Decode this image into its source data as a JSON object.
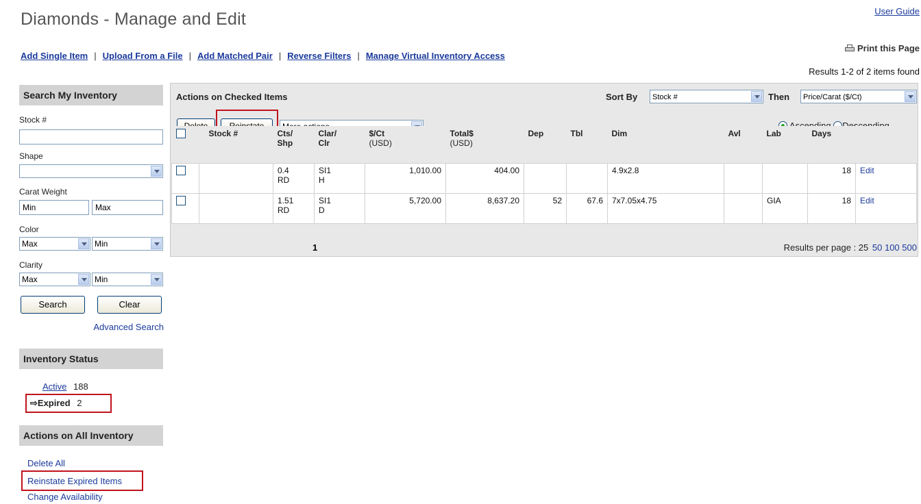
{
  "page": {
    "title": "Diamonds - Manage and Edit",
    "user_guide": "User Guide",
    "print": "Print this Page",
    "results_found": "Results 1-2 of 2 items found"
  },
  "nav": [
    {
      "label": "Add Single Item"
    },
    {
      "label": "Upload From a File"
    },
    {
      "label": "Add Matched Pair"
    },
    {
      "label": "Reverse Filters"
    },
    {
      "label": "Manage Virtual Inventory Access"
    }
  ],
  "search": {
    "heading": "Search My Inventory",
    "stock_label": "Stock #",
    "stock_value": "",
    "shape_label": "Shape",
    "shape_value": "",
    "carat_label": "Carat Weight",
    "carat_min": "Min",
    "carat_max": "Max",
    "color_label": "Color",
    "color_from": "Max",
    "color_to": "Min",
    "clarity_label": "Clarity",
    "clarity_from": "Max",
    "clarity_to": "Min",
    "search_button": "Search",
    "clear_button": "Clear",
    "advanced": "Advanced Search"
  },
  "status": {
    "heading": "Inventory Status",
    "active_label": "Active",
    "active_count": "188",
    "expired_label": "Expired",
    "expired_count": "2"
  },
  "actions_all": {
    "heading": "Actions on All Inventory",
    "items": [
      "Delete All",
      "Reinstate Expired Items",
      "Change Availability"
    ]
  },
  "checked": {
    "heading": "Actions on Checked Items",
    "delete": "Delete",
    "reinstate": "Reinstate",
    "more_actions": "More actions",
    "sort_by_label": "Sort By",
    "sort_by_value": "Stock #",
    "then_label": "Then",
    "then_value": "Price/Carat ($/Ct)",
    "ascending": "Ascending",
    "descending": "Descending"
  },
  "table": {
    "headers": [
      "Stock #",
      "Cts/",
      "Shp",
      "Clar/",
      "Clr",
      "$/Ct",
      "(USD)",
      "Total$",
      "(USD)",
      "Dep",
      "Tbl",
      "Dim",
      "Avl",
      "Lab",
      "Days"
    ],
    "rows": [
      {
        "stock": "",
        "cts": "0.4",
        "shp": "RD",
        "clar": "SI1",
        "clr": "H",
        "pct": "1,010.00",
        "total": "404.00",
        "dep": "",
        "tbl": "",
        "dim": "4.9x2.8",
        "avl": "",
        "lab": "",
        "days": "18",
        "edit": "Edit"
      },
      {
        "stock": "",
        "cts": "1.51",
        "shp": "RD",
        "clar": "SI1",
        "clr": "D",
        "pct": "5,720.00",
        "total": "8,637.20",
        "dep": "52",
        "tbl": "67.6",
        "dim": "7x7.05x4.75",
        "avl": "",
        "lab": "GIA",
        "days": "18",
        "edit": "Edit"
      }
    ],
    "page_number": "1",
    "per_page_label": "Results per page : 25",
    "per_page_options": [
      "50",
      "100",
      "500"
    ]
  }
}
